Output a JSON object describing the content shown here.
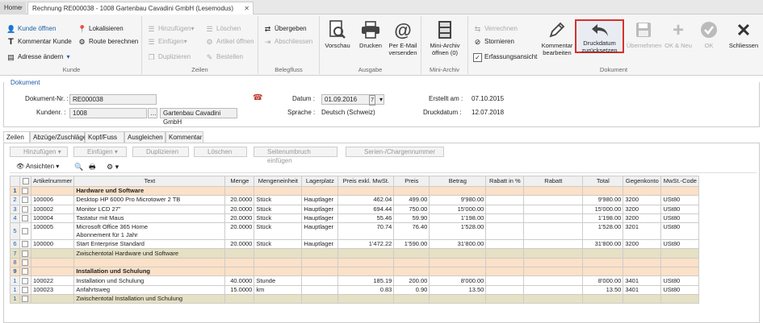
{
  "tabs": {
    "home": "Home",
    "document": "Rechnung RE000038 - 1008 Gartenbau Cavadini GmbH (Lesemodus)"
  },
  "ribbon": {
    "kunde": {
      "label": "Kunde",
      "open": "Kunde öffnen",
      "comment": "Kommentar Kunde",
      "address": "Adresse ändern",
      "localize": "Lokalisieren",
      "route": "Route berechnen"
    },
    "zeilen": {
      "label": "Zeilen",
      "add": "Hinzufügen",
      "delete": "Löschen",
      "insert": "Einfügen",
      "open_article": "Artikel öffnen",
      "duplicate": "Duplizieren",
      "order": "Bestellen"
    },
    "belegfluss": {
      "label": "Belegfluss",
      "transfer": "Übergeben",
      "close": "Abschliessen"
    },
    "ausgabe": {
      "label": "Ausgabe",
      "preview": "Vorschau",
      "print": "Drucken",
      "email": "Per E-Mail versenden"
    },
    "miniarchiv": {
      "label": "Mini-Archiv",
      "open": "Mini-Archiv öffnen (0)"
    },
    "dokument": {
      "label": "Dokument",
      "offset": "Verrechnen",
      "cancel": "Stornieren",
      "capture_view": "Erfassungsansicht",
      "comment_edit": "Kommentar bearbeiten",
      "reset_print": "Druckdatum zurücksetzen",
      "take": "Übernehmen",
      "ok_new": "OK & Neu",
      "ok": "OK",
      "close": "Schliessen"
    }
  },
  "doc": {
    "section": "Dokument",
    "docnr_label": "Dokument-Nr. :",
    "docnr": "RE000038",
    "custnr_label": "Kundenr. :",
    "custnr": "1008",
    "custname": "Gartenbau Cavadini GmbH",
    "date_label": "Datum :",
    "date": "01.09.2016",
    "lang_label": "Sprache :",
    "lang": "Deutsch (Schweiz)",
    "created_label": "Erstellt am :",
    "created": "07.10.2015",
    "printdate_label": "Druckdatum :",
    "printdate": "12.07.2018"
  },
  "content_tabs": [
    "Zeilen",
    "Abzüge/Zuschläge",
    "Kopf/Fuss",
    "Ausgleichen",
    "Kommentar"
  ],
  "line_toolbar": {
    "add": "Hinzufügen",
    "insert": "Einfügen",
    "duplicate": "Duplizieren",
    "delete": "Löschen",
    "page_break": "Seitenumbruch einfügen",
    "serial": "Serien-/Chargennummer",
    "views": "Ansichten"
  },
  "grid": {
    "headers": [
      "Artikelnummer",
      "Text",
      "Menge",
      "Mengeneinheit",
      "Lagerplatz",
      "Preis exkl. MwSt.",
      "Preis",
      "Betrag",
      "Rabatt in %",
      "Rabatt",
      "Total",
      "Gegenkonto",
      "MwSt.-Code"
    ],
    "rows": [
      {
        "n": "1",
        "type": "grp",
        "c": [
          "",
          "Hardware und Software",
          "",
          "",
          "",
          "",
          "",
          "",
          "",
          "",
          "",
          "",
          ""
        ]
      },
      {
        "n": "2",
        "type": "item",
        "c": [
          "100006",
          "Desktop HP 6000 Pro Microtower 2 TB",
          "20.0000",
          "Stück",
          "Hauptlager",
          "462.04",
          "499.00",
          "9'980.00",
          "",
          "",
          "9'980.00",
          "3200",
          "USt80"
        ]
      },
      {
        "n": "3",
        "type": "item",
        "c": [
          "100002",
          "Monitor LCD 27\"",
          "20.0000",
          "Stück",
          "Hauptlager",
          "694.44",
          "750.00",
          "15'000.00",
          "",
          "",
          "15'000.00",
          "3200",
          "USt80"
        ]
      },
      {
        "n": "4",
        "type": "item",
        "c": [
          "100004",
          "Tastatur mit Maus",
          "20.0000",
          "Stück",
          "Hauptlager",
          "55.46",
          "59.90",
          "1'198.00",
          "",
          "",
          "1'198.00",
          "3200",
          "USt80"
        ]
      },
      {
        "n": "5",
        "type": "item2",
        "c": [
          "100005",
          "Microsoft Office 365 Home",
          "20.0000",
          "Stück",
          "Hauptlager",
          "70.74",
          "76.40",
          "1'528.00",
          "",
          "",
          "1'528.00",
          "3201",
          "USt80"
        ],
        "c2": "Abonnement für 1 Jahr"
      },
      {
        "n": "6",
        "type": "item",
        "c": [
          "100000",
          "Start Enterprise Standard",
          "20.0000",
          "Stück",
          "Hauptlager",
          "1'472.22",
          "1'590.00",
          "31'800.00",
          "",
          "",
          "31'800.00",
          "3200",
          "USt80"
        ]
      },
      {
        "n": "7",
        "type": "sub",
        "c": [
          "",
          "Zwischentotal Hardware und Software",
          "",
          "",
          "",
          "",
          "",
          "",
          "",
          "",
          "",
          "",
          ""
        ]
      },
      {
        "n": "8",
        "type": "empty",
        "c": [
          "",
          "",
          "",
          "",
          "",
          "",
          "",
          "",
          "",
          "",
          "",
          "",
          ""
        ]
      },
      {
        "n": "9",
        "type": "grp",
        "c": [
          "",
          "Installation und Schulung",
          "",
          "",
          "",
          "",
          "",
          "",
          "",
          "",
          "",
          "",
          ""
        ]
      },
      {
        "n": "1",
        "type": "item",
        "c": [
          "100022",
          "Installation und Schulung",
          "40.0000",
          "Stunde",
          "",
          "185.19",
          "200.00",
          "8'000.00",
          "",
          "",
          "8'000.00",
          "3401",
          "USt80"
        ]
      },
      {
        "n": "1",
        "type": "item",
        "c": [
          "100023",
          "Anfahrtsweg",
          "15.0000",
          "km",
          "",
          "0.83",
          "0.90",
          "13.50",
          "",
          "",
          "13.50",
          "3401",
          "USt80"
        ]
      },
      {
        "n": "1",
        "type": "sub",
        "c": [
          "",
          "Zwischentotal Installation und Schulung",
          "",
          "",
          "",
          "",
          "",
          "",
          "",
          "",
          "",
          "",
          ""
        ]
      }
    ]
  }
}
